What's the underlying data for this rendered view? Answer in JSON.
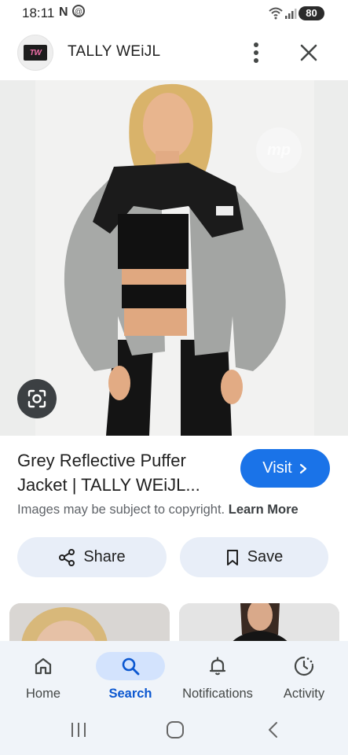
{
  "status_bar": {
    "time": "18:11",
    "notification_n": "N",
    "notification_at": "@",
    "battery": "80"
  },
  "header": {
    "site_name": "TALLY WEiJL",
    "logo_text": "TW"
  },
  "image": {
    "description_icon": "google-lens-icon",
    "watermark_text": "mp"
  },
  "info": {
    "title": "Grey Reflective Puffer Jacket | TALLY WEiJL...",
    "visit_label": "Visit",
    "copyright_text": "Images may be subject to copyright.",
    "learn_more_label": "Learn More"
  },
  "actions": {
    "share_label": "Share",
    "save_label": "Save"
  },
  "bottom_nav": {
    "items": [
      {
        "label": "Home",
        "icon": "home-icon"
      },
      {
        "label": "Search",
        "icon": "search-icon"
      },
      {
        "label": "Notifications",
        "icon": "bell-icon"
      },
      {
        "label": "Activity",
        "icon": "activity-icon"
      }
    ],
    "active": "Search"
  },
  "colors": {
    "accent": "#1a73e8",
    "active_nav": "#0b57d0",
    "button_bg": "#e8eef8",
    "nav_bg": "#f0f4f9"
  }
}
